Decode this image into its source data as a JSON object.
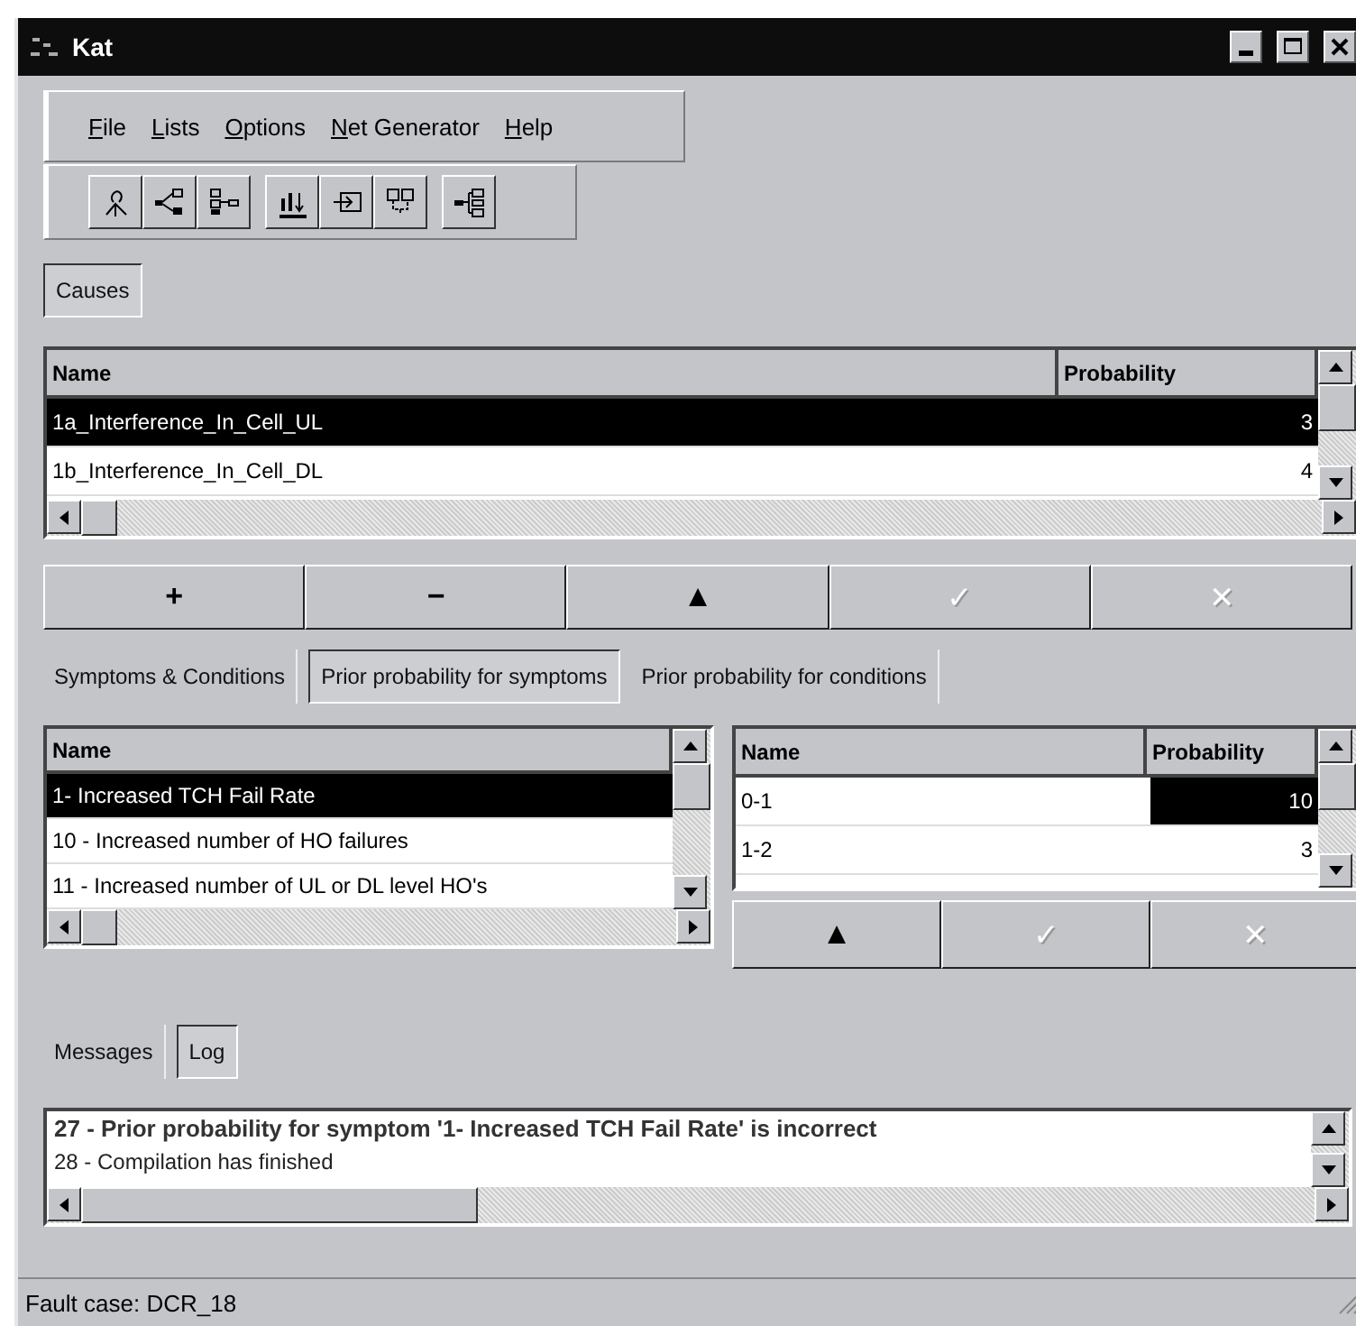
{
  "window": {
    "title": "Kat"
  },
  "menu": [
    {
      "label": "File"
    },
    {
      "label": "Lists"
    },
    {
      "label": "Options"
    },
    {
      "label": "Net Generator"
    },
    {
      "label": "Help"
    }
  ],
  "causes_tabs": [
    {
      "label": "Causes",
      "selected": true
    }
  ],
  "causes_table": {
    "columns": [
      "Name",
      "Probability"
    ],
    "rows": [
      {
        "name": "1a_Interference_In_Cell_UL",
        "probability": "3",
        "selected": true
      },
      {
        "name": "1b_Interference_In_Cell_DL",
        "probability": "4",
        "selected": false
      }
    ]
  },
  "causes_buttons": [
    {
      "label": "+",
      "disabled": false
    },
    {
      "label": "−",
      "disabled": false
    },
    {
      "label": "▲",
      "disabled": false
    },
    {
      "label": "✓",
      "disabled": true
    },
    {
      "label": "✕",
      "disabled": true
    }
  ],
  "tabs": [
    {
      "label": "Symptoms & Conditions",
      "selected": false
    },
    {
      "label": "Prior probability for symptoms",
      "selected": true
    },
    {
      "label": "Prior probability for conditions",
      "selected": false
    }
  ],
  "symptoms_table": {
    "columns": [
      "Name"
    ],
    "rows": [
      {
        "name": "1- Increased TCH Fail Rate",
        "selected": true
      },
      {
        "name": "10 - Increased number of HO failures",
        "selected": false
      },
      {
        "name": "11 - Increased number of UL or DL level HO's",
        "selected": false
      }
    ]
  },
  "prior_table": {
    "columns": [
      "Name",
      "Probability"
    ],
    "rows": [
      {
        "name": "0-1",
        "probability": "10",
        "selected": true
      },
      {
        "name": "1-2",
        "probability": "3",
        "selected": false
      }
    ]
  },
  "prior_buttons": [
    {
      "label": "▲",
      "disabled": false
    },
    {
      "label": "✓",
      "disabled": true
    },
    {
      "label": "✕",
      "disabled": true
    }
  ],
  "message_tabs": [
    {
      "label": "Messages",
      "selected": false
    },
    {
      "label": "Log",
      "selected": true
    }
  ],
  "log": [
    {
      "text": "27 - Prior probability for symptom '1- Increased TCH Fail Rate' is incorrect",
      "kind": "error"
    },
    {
      "text": "28 - Compilation has finished",
      "kind": "info"
    }
  ],
  "status_bar": {
    "text": "Fault case: DCR_18"
  }
}
